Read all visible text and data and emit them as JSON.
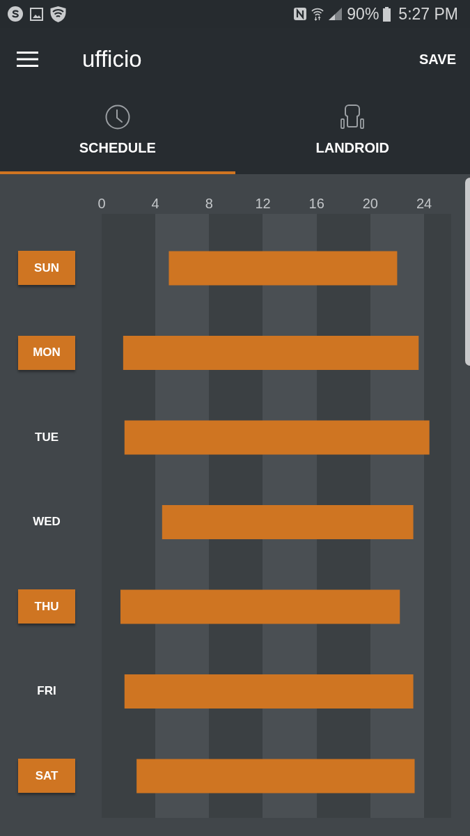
{
  "status_bar": {
    "battery": "90%",
    "time": "5:27 PM"
  },
  "app_bar": {
    "title": "ufficio",
    "action": "SAVE"
  },
  "tabs": [
    {
      "label": "SCHEDULE",
      "selected": true
    },
    {
      "label": "LANDROID",
      "selected": false
    }
  ],
  "schedule": {
    "days": [
      {
        "selected": true
      },
      {
        "selected": true
      },
      {
        "selected": false
      },
      {
        "selected": false
      },
      {
        "selected": true
      },
      {
        "selected": false
      },
      {
        "selected": true
      }
    ],
    "chart_data": {
      "type": "candlestick",
      "orientation": "horizontal",
      "categories": [
        "SUN",
        "MON",
        "TUE",
        "WED",
        "THU",
        "FRI",
        "SAT"
      ],
      "xlim": [
        0,
        26
      ],
      "xticks": [
        {
          "value": 0,
          "label": "0"
        },
        {
          "value": 4,
          "label": "4"
        },
        {
          "value": 8,
          "label": "8"
        },
        {
          "value": 12,
          "label": "12"
        },
        {
          "value": 16,
          "label": "16"
        },
        {
          "value": 20,
          "label": "20"
        },
        {
          "value": 24,
          "label": "24"
        }
      ],
      "series": [
        {
          "color": "#cf7522",
          "ohlc": [
            [
              5.0,
              22.0,
              5.0,
              22.0
            ],
            [
              1.6,
              23.6,
              1.6,
              23.6
            ],
            [
              1.7,
              24.4,
              1.7,
              24.4
            ],
            [
              4.5,
              23.2,
              4.5,
              23.2
            ],
            [
              1.4,
              22.2,
              1.4,
              22.2
            ],
            [
              1.7,
              23.2,
              1.7,
              23.2
            ],
            [
              2.6,
              23.3,
              2.6,
              23.3
            ]
          ]
        }
      ]
    }
  }
}
